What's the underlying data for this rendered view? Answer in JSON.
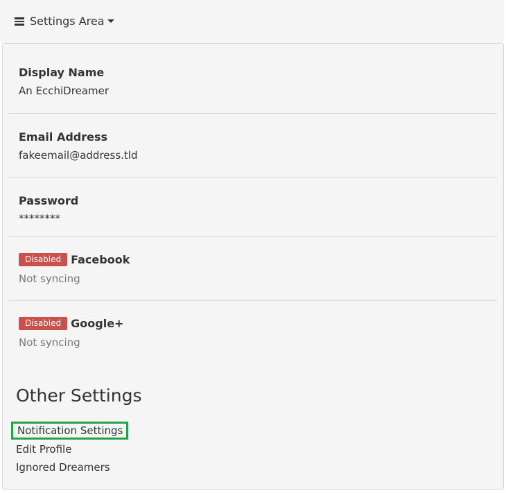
{
  "header": {
    "menu_label": "Settings Area"
  },
  "account": {
    "display_name": {
      "label": "Display Name",
      "value": "An EcchiDreamer"
    },
    "email": {
      "label": "Email Address",
      "value": "fakeemail@address.tld"
    },
    "password": {
      "label": "Password",
      "value": "********"
    },
    "facebook": {
      "badge": "Disabled",
      "label": "Facebook",
      "status": "Not syncing"
    },
    "google": {
      "badge": "Disabled",
      "label": "Google+",
      "status": "Not syncing"
    }
  },
  "other_settings": {
    "heading": "Other Settings",
    "links": {
      "notification_settings": "Notification Settings",
      "edit_profile": "Edit Profile",
      "ignored_dreamers": "Ignored Dreamers"
    }
  },
  "colors": {
    "badge_disabled": "#c9504b",
    "highlight_border": "#22a249",
    "background": "#f5f5f5"
  },
  "icons": {
    "menu": "hamburger-icon",
    "dropdown": "caret-down-icon"
  }
}
